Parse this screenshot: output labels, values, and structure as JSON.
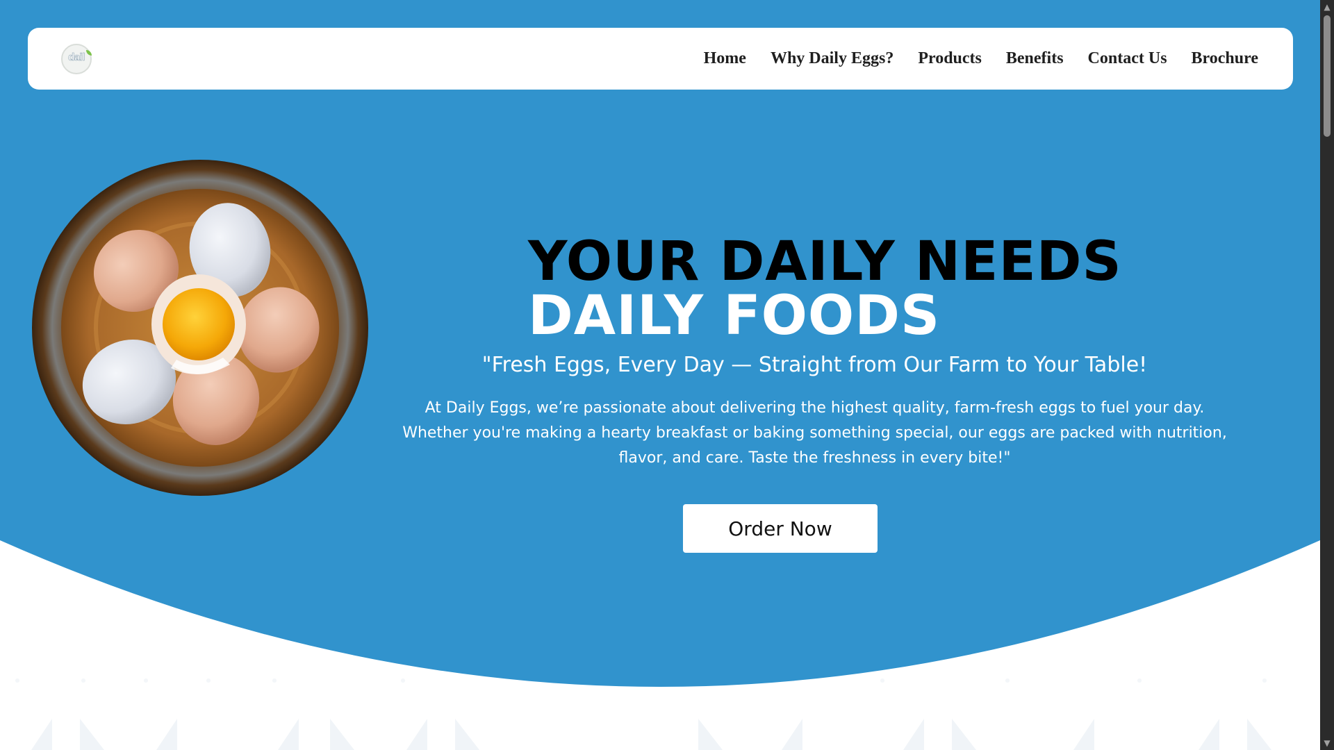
{
  "colors": {
    "hero_blue": "#3193cd",
    "nav_bg": "#ffffff",
    "nav_text": "#1f1f1f",
    "headline_dark": "#000000",
    "headline_light": "#ffffff"
  },
  "nav": {
    "logo_text": "dail",
    "links": [
      "Home",
      "Why Daily Eggs?",
      "Products",
      "Benefits",
      "Contact Us",
      "Brochure"
    ]
  },
  "hero": {
    "headline_line1": "YOUR DAILY NEEDS",
    "headline_line2": "DAILY FOODS",
    "tagline": "\"Fresh Eggs, Every Day — Straight from Our Farm to Your Table!",
    "description": "At Daily Eggs, we’re passionate about delivering the highest quality, farm-fresh eggs to fuel your day. Whether you're making a hearty breakfast or baking something special, our eggs are packed with nutrition, flavor, and care. Taste the freshness in every bite!\"",
    "order_button": "Order Now"
  },
  "scrollbar": {
    "up_icon": "▲",
    "down_icon": "▼"
  }
}
